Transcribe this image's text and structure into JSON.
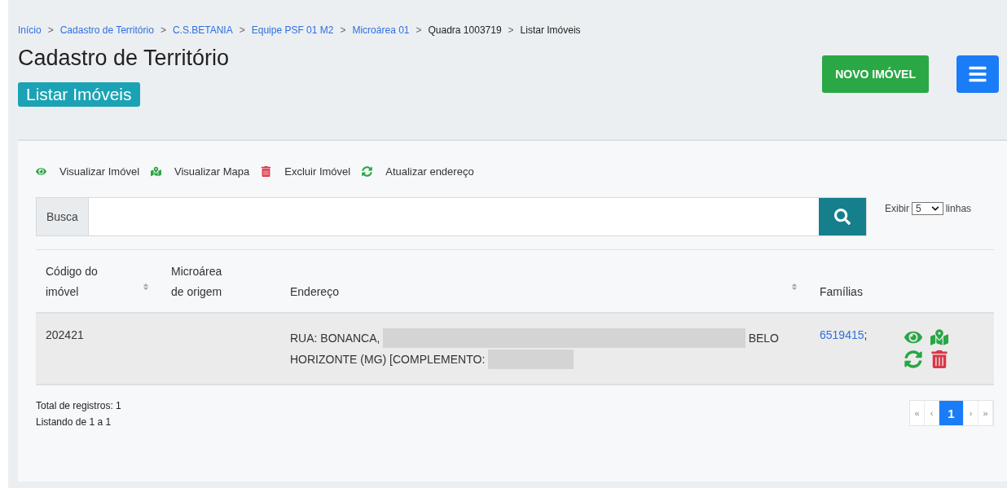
{
  "breadcrumb": [
    {
      "label": "Início",
      "link": true
    },
    {
      "label": "Cadastro de Território",
      "link": true
    },
    {
      "label": "C.S.BETANIA",
      "link": true
    },
    {
      "label": "Equipe PSF 01 M2",
      "link": true
    },
    {
      "label": "Microárea 01",
      "link": true
    },
    {
      "label": "Quadra 1003719",
      "link": false
    },
    {
      "label": "Listar Imóveis",
      "link": false
    }
  ],
  "breadcrumb_separator": ">",
  "title": "Cadastro de Território",
  "subtitle_badge": "Listar Imóveis",
  "new_button": "NOVO IMÓVEL",
  "legend": [
    {
      "kind": "view",
      "label": "Visualizar Imóvel"
    },
    {
      "kind": "map",
      "label": "Visualizar Mapa"
    },
    {
      "kind": "delete",
      "label": "Excluir Imóvel"
    },
    {
      "kind": "refresh",
      "label": "Atualizar endereço"
    }
  ],
  "search": {
    "label": "Busca"
  },
  "page_size": {
    "prefix": "Exibir",
    "value": "5",
    "suffix": "linhas"
  },
  "table": {
    "columns": [
      {
        "label": "Código do imóvel",
        "sortable": true
      },
      {
        "label": "Microárea de origem",
        "sortable": false
      },
      {
        "label": "Endereço",
        "sortable": true
      },
      {
        "label": "Famílias",
        "sortable": false
      }
    ],
    "rows": [
      {
        "code": "202421",
        "address_lines": [
          [
            {
              "kind": "text",
              "text": "RUA: BONANCA,"
            },
            {
              "kind": "redacted"
            },
            {
              "kind": "text",
              "text": "BELO"
            }
          ],
          [
            {
              "kind": "text",
              "text": "HORIZONTE (MG) [COMPLEMENTO:"
            },
            {
              "kind": "redacted"
            }
          ]
        ],
        "family_link": "6519415",
        "family_sep": ";",
        "actions": [
          {
            "kind": "view"
          },
          {
            "kind": "map"
          },
          {
            "kind": "refresh"
          },
          {
            "kind": "delete"
          }
        ]
      }
    ]
  },
  "summary": [
    "Total de registros: 1",
    "Listando de 1 a 1"
  ],
  "pagination": [
    {
      "label": "«",
      "selected": false
    },
    {
      "label": "‹",
      "selected": false
    },
    {
      "label": "1",
      "selected": true
    },
    {
      "label": "›",
      "selected": false
    },
    {
      "label": "»",
      "selected": false
    }
  ]
}
